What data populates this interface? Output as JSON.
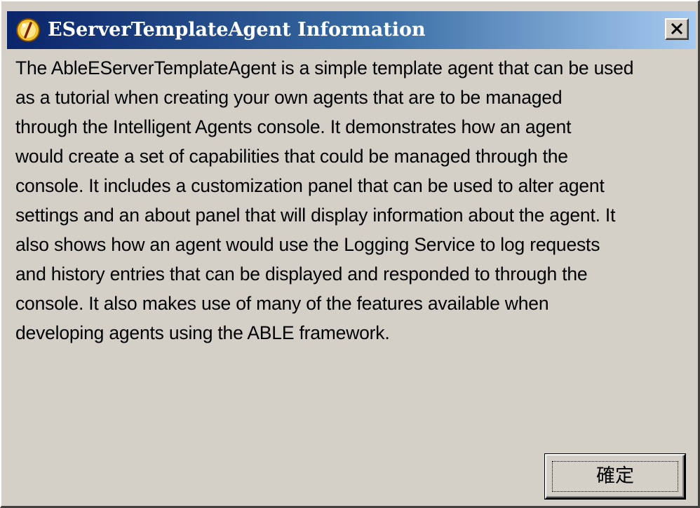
{
  "dialog": {
    "title": "EServerTemplateAgent Information",
    "title_icon": "info-lightbulb-icon",
    "close_label": "close",
    "description_lines": [
      "The AbleEServerTemplateAgent is a simple template agent that can be used",
      "as a tutorial when creating your own agents that are to be managed",
      "through the Intelligent Agents console.  It demonstrates how an agent",
      "would create a set of capabilities that could be managed through the",
      "console.  It includes a customization panel that can be used to alter agent",
      "settings and an about panel that will display information about the agent.  It",
      "also shows how an agent would use the Logging Service to log requests",
      "and history entries that can be displayed and responded to through the",
      "console.  It also makes use of many of the features available when",
      "developing agents using the ABLE framework."
    ],
    "ok_label": "確定"
  },
  "colors": {
    "titlebar_start": "#0a246a",
    "titlebar_end": "#a6caf0",
    "face": "#d4d0c8"
  }
}
